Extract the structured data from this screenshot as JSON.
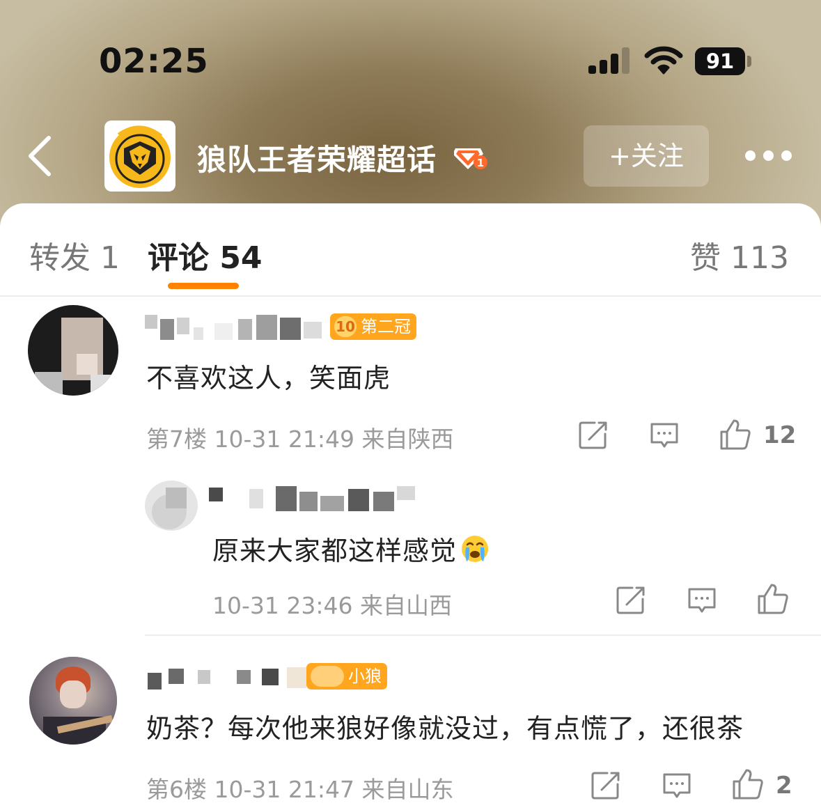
{
  "status_bar": {
    "time": "02:25",
    "battery": "91"
  },
  "header": {
    "title": "狼队王者荣耀超话",
    "level_badge": "1",
    "follow_label": "+关注",
    "logo_icon": "wolf-logo"
  },
  "tabs": {
    "repost": "转发 1",
    "comment": "评论 54",
    "like": "赞 113"
  },
  "comments": [
    {
      "badge_level": "10",
      "badge_text": "第二冠",
      "text": "不喜欢这人，笑面虎",
      "floor": "第7楼",
      "time": "10-31 21:49",
      "location": "来自陕西",
      "likes": "12"
    },
    {
      "badge_text": "小狼",
      "text": "奶茶？每次他来狼好像就没过，有点慌了，还很茶",
      "floor": "第6楼",
      "time": "10-31 21:47",
      "location": "来自山东",
      "likes": "2"
    }
  ],
  "reply": {
    "text": "原来大家都这样感觉",
    "emoji": "crying-face",
    "time": "10-31 23:46",
    "location": "来自山西"
  },
  "colors": {
    "accent": "#ff8200",
    "badge": "#ffa51e"
  }
}
